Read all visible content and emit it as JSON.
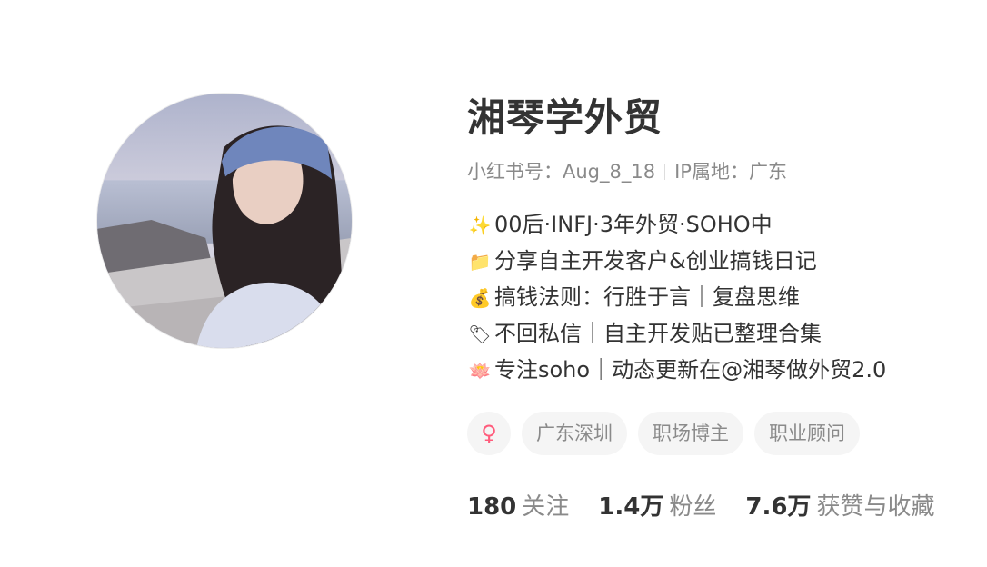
{
  "profile": {
    "avatar_alt": "avatar",
    "name": "湘琴学外贸",
    "id_label": "小红书号：Aug_8_18",
    "ip_label": "IP属地：广东",
    "bio": [
      {
        "icon": "✨",
        "icon_name": "sparkles-icon",
        "text": "00后·INFJ·3年外贸·SOHO中"
      },
      {
        "icon": "📁",
        "icon_name": "folder-icon",
        "text": "分享自主开发客户&创业搞钱日记"
      },
      {
        "icon": "💰",
        "icon_name": "money-bag-icon",
        "text": "搞钱法则：行胜于言｜复盘思维"
      },
      {
        "icon": "🏷",
        "icon_name": "tag-icon",
        "text": "不回私信｜自主开发贴已整理合集"
      },
      {
        "icon": "🪷",
        "icon_name": "lotus-icon",
        "text": "专注soho｜动态更新在@湘琴做外贸2.0"
      }
    ],
    "tags": {
      "gender_symbol": "♀",
      "items": [
        "广东深圳",
        "职场博主",
        "职业顾问"
      ]
    },
    "stats": [
      {
        "num": "180",
        "label": "关注"
      },
      {
        "num": "1.4万",
        "label": "粉丝"
      },
      {
        "num": "7.6万",
        "label": "获赞与收藏"
      }
    ]
  },
  "colors": {
    "text": "#333333",
    "muted": "#8a8a8a",
    "tag_bg": "#f5f5f5",
    "female": "#ff5c7c"
  }
}
